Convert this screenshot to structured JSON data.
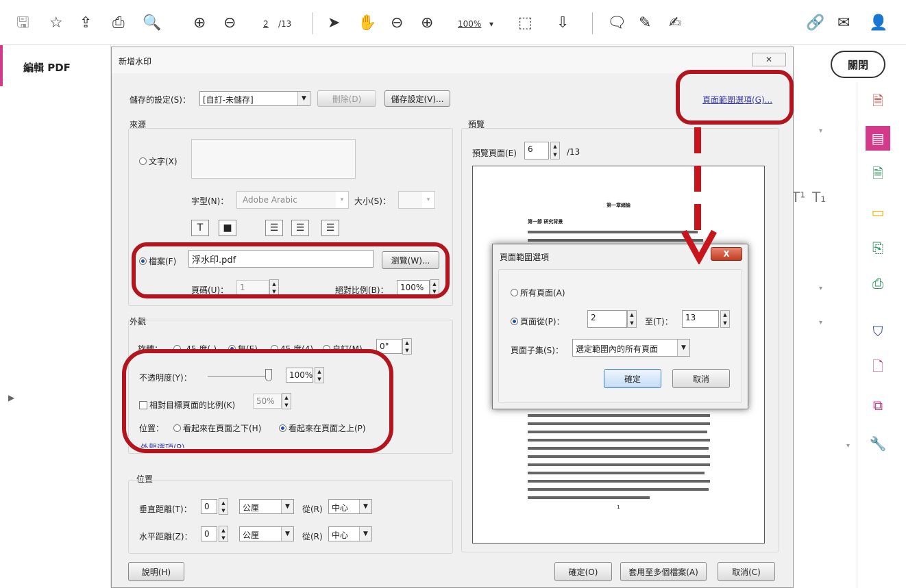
{
  "toolbar": {
    "page_current": "2",
    "page_total": "/13",
    "zoom": "100%"
  },
  "left_pane": {
    "title": "編輯 PDF"
  },
  "right_pane": {
    "close_label": "關閉"
  },
  "main_dialog": {
    "title": "新增水印",
    "close": "✕",
    "saved_settings_label": "儲存的設定(S)：",
    "saved_settings_value": "[自訂-未儲存]",
    "delete_button": "刪除(D)",
    "save_settings_button": "儲存設定(V)...",
    "page_range_link": "頁面範圍選項(G)...",
    "source": {
      "heading": "來源",
      "text_option": "文字(X)",
      "font_label": "字型(N)：",
      "font_value": "Adobe Arabic",
      "size_label": "大小(S)：",
      "file_option": "檔案(F)",
      "file_value": "浮水印.pdf",
      "browse_button": "瀏覽(W)...",
      "page_label": "頁碼(U)：",
      "page_value": "1",
      "scale_label": "絕對比例(B)：",
      "scale_value": "100%"
    },
    "appearance": {
      "heading": "外觀",
      "rotation_label": "旋轉：",
      "rot_neg45": "-45 度(-)",
      "rot_none": "無(E)",
      "rot_45": "45 度(4)",
      "rot_custom": "自訂(M)",
      "rot_value": "0°",
      "opacity_label": "不透明度(Y)：",
      "opacity_value": "100%",
      "relative_label": "相對目標頁面的比例(K)",
      "relative_value": "50%",
      "position_label": "位置：",
      "behind_option": "看起來在頁面之下(H)",
      "front_option": "看起來在頁面之上(P)",
      "appearance_options_link": "外觀選項(P)..."
    },
    "position": {
      "heading": "位置",
      "vertical_label": "垂直距離(T)：",
      "vertical_value": "0",
      "unit_value": "公厘",
      "from_label": "從(R)",
      "from_value": "中心",
      "horizontal_label": "水平距離(Z)：",
      "horizontal_value": "0"
    },
    "preview": {
      "heading": "預覽",
      "preview_page_label": "預覽頁面(E)",
      "preview_page_value": "6",
      "preview_page_total": "/13",
      "doc_chapter": "第一章緒論",
      "doc_section": "第一節 研究背景",
      "doc_page_number": "1"
    },
    "help_button": "說明(H)",
    "ok_button": "確定(O)",
    "apply_multi_button": "套用至多個檔案(A)",
    "cancel_button": "取消(C)"
  },
  "range_dialog": {
    "title": "頁面範圍選項",
    "close": "X",
    "all_pages": "所有頁面(A)",
    "pages_from": "頁面從(P)：",
    "from_value": "2",
    "to_label": "至(T)：",
    "to_value": "13",
    "subset_label": "頁面子集(S)：",
    "subset_value": "選定範圍內的所有頁面",
    "ok_button": "確定",
    "cancel_button": "取消"
  },
  "colors": {
    "annotation_red": "#b3151e",
    "accent_pink": "#d33a8a",
    "link_blue": "#3a3aa8"
  }
}
